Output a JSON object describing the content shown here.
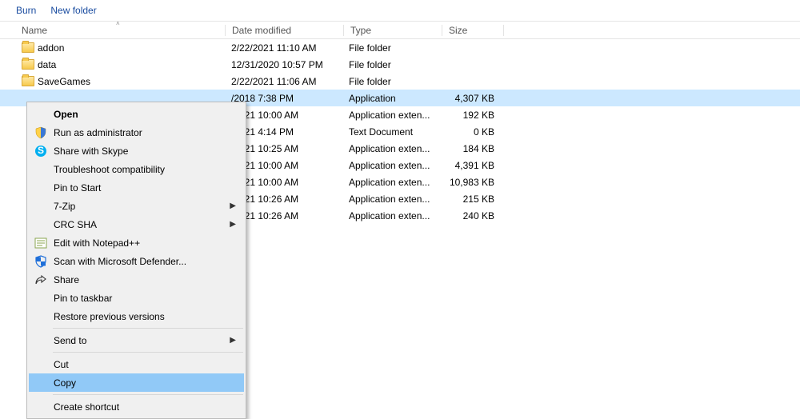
{
  "toolbar": {
    "burn": "Burn",
    "new_folder": "New folder"
  },
  "columns": {
    "name": "Name",
    "date": "Date modified",
    "type": "Type",
    "size": "Size"
  },
  "rows": [
    {
      "name": "addon",
      "date": "2/22/2021 11:10 AM",
      "type": "File folder",
      "size": "",
      "folder": true
    },
    {
      "name": "data",
      "date": "12/31/2020 10:57 PM",
      "type": "File folder",
      "size": "",
      "folder": true
    },
    {
      "name": "SaveGames",
      "date": "2/22/2021 11:06 AM",
      "type": "File folder",
      "size": "",
      "folder": true
    },
    {
      "name": "",
      "date": "/2018 7:38 PM",
      "type": "Application",
      "size": "4,307 KB",
      "folder": false,
      "selected": true
    },
    {
      "name": "",
      "date": "/2021 10:00 AM",
      "type": "Application exten...",
      "size": "192 KB",
      "folder": false
    },
    {
      "name": "",
      "date": "/2021 4:14 PM",
      "type": "Text Document",
      "size": "0 KB",
      "folder": false
    },
    {
      "name": "",
      "date": "/2021 10:25 AM",
      "type": "Application exten...",
      "size": "184 KB",
      "folder": false
    },
    {
      "name": "",
      "date": "/2021 10:00 AM",
      "type": "Application exten...",
      "size": "4,391 KB",
      "folder": false
    },
    {
      "name": "",
      "date": "/2021 10:00 AM",
      "type": "Application exten...",
      "size": "10,983 KB",
      "folder": false
    },
    {
      "name": "",
      "date": "/2021 10:26 AM",
      "type": "Application exten...",
      "size": "215 KB",
      "folder": false
    },
    {
      "name": "",
      "date": "/2021 10:26 AM",
      "type": "Application exten...",
      "size": "240 KB",
      "folder": false
    }
  ],
  "context_menu": [
    {
      "label": "Open",
      "bold": true
    },
    {
      "label": "Run as administrator",
      "icon": "shield"
    },
    {
      "label": "Share with Skype",
      "icon": "skype"
    },
    {
      "label": "Troubleshoot compatibility"
    },
    {
      "label": "Pin to Start"
    },
    {
      "label": "7-Zip",
      "arrow": true
    },
    {
      "label": "CRC SHA",
      "arrow": true
    },
    {
      "label": "Edit with Notepad++",
      "icon": "npp"
    },
    {
      "label": "Scan with Microsoft Defender...",
      "icon": "defender"
    },
    {
      "label": "Share",
      "icon": "share"
    },
    {
      "label": "Pin to taskbar"
    },
    {
      "label": "Restore previous versions"
    },
    {
      "sep": true
    },
    {
      "label": "Send to",
      "arrow": true
    },
    {
      "sep": true
    },
    {
      "label": "Cut"
    },
    {
      "label": "Copy",
      "highlight": true
    },
    {
      "sep": true
    },
    {
      "label": "Create shortcut"
    }
  ]
}
